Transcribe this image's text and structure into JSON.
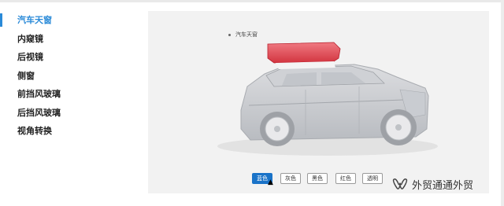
{
  "sidebar": {
    "items": [
      {
        "label": "汽车天窗",
        "active": true
      },
      {
        "label": "内窥镜"
      },
      {
        "label": "后视镜"
      },
      {
        "label": "侧窗"
      },
      {
        "label": "前挡风玻璃"
      },
      {
        "label": "后挡风玻璃"
      },
      {
        "label": "视角转换"
      }
    ]
  },
  "stage": {
    "callout_label": "汽车天窗",
    "highlight_color": "#e04a55"
  },
  "color_options": {
    "active_index": 0,
    "buttons": [
      "蓝色",
      "灰色",
      "黑色",
      "红色",
      "透明"
    ]
  },
  "watermark": {
    "text": "外贸通通外贸",
    "icon": "wechat-channel-icon"
  },
  "colors": {
    "accent": "#2a8ad8",
    "button_active": "#1a73c8",
    "stage_bg": "#f2f2f2"
  }
}
